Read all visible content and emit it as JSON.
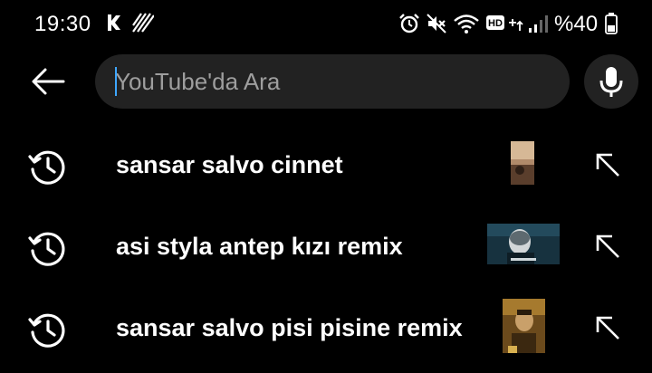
{
  "status_bar": {
    "time": "19:30",
    "battery_text": "%40",
    "icons": [
      "kodi-icon",
      "stripe-pattern-icon",
      "alarm-icon",
      "mute-icon",
      "wifi-icon",
      "hd-plus-icon",
      "signal-icon",
      "battery-icon"
    ]
  },
  "search": {
    "placeholder": "YouTube'da Ara",
    "value": ""
  },
  "suggestions": [
    {
      "text": "sansar salvo cinnet",
      "thumbnail": "thumbnail-image",
      "icon": "history-icon",
      "action_icon": "fill-query-arrow-icon"
    },
    {
      "text": "asi styla antep kızı remix",
      "thumbnail": "thumbnail-image",
      "icon": "history-icon",
      "action_icon": "fill-query-arrow-icon"
    },
    {
      "text": "sansar salvo pisi pisine remix",
      "thumbnail": "thumbnail-image",
      "icon": "history-icon",
      "action_icon": "fill-query-arrow-icon"
    }
  ],
  "colors": {
    "background": "#000000",
    "search_box": "#222222",
    "caret": "#3ea6ff",
    "text": "#ffffff",
    "placeholder": "#9e9e9e"
  }
}
